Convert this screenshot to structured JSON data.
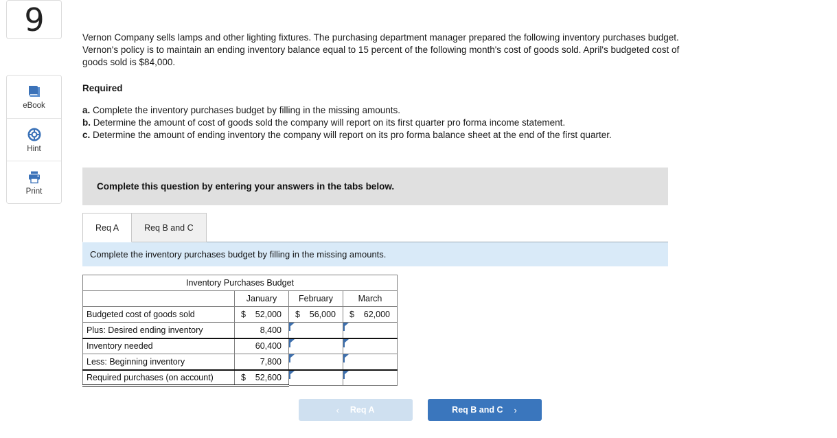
{
  "question_number": "9",
  "tools": [
    {
      "label": "eBook",
      "icon": "book-icon"
    },
    {
      "label": "Hint",
      "icon": "lifebuoy-icon"
    },
    {
      "label": "Print",
      "icon": "printer-icon"
    }
  ],
  "problem": {
    "paragraph": "Vernon Company sells lamps and other lighting fixtures. The purchasing department manager prepared the following inventory purchases budget. Vernon's policy is to maintain an ending inventory balance equal to 15 percent of the following month's cost of goods sold. April's budgeted cost of goods sold is $84,000.",
    "required_heading": "Required",
    "requirements": [
      {
        "marker": "a.",
        "text": "Complete the inventory purchases budget by filling in the missing amounts."
      },
      {
        "marker": "b.",
        "text": "Determine the amount of cost of goods sold the company will report on its first quarter pro forma income statement."
      },
      {
        "marker": "c.",
        "text": "Determine the amount of ending inventory the company will report on its pro forma balance sheet at the end of the first quarter."
      }
    ]
  },
  "instruction_bar": "Complete this question by entering your answers in the tabs below.",
  "tabs": [
    {
      "label": "Req A",
      "active": true
    },
    {
      "label": "Req B and C",
      "active": false
    }
  ],
  "tab_instruction": "Complete the inventory purchases budget by filling in the missing amounts.",
  "table": {
    "title": "Inventory Purchases Budget",
    "columns": [
      "January",
      "February",
      "March"
    ],
    "rows": [
      {
        "label": "Budgeted cost of goods sold",
        "cells": [
          {
            "currency": "$",
            "value": "52,000",
            "input": false
          },
          {
            "currency": "$",
            "value": "56,000",
            "input": false
          },
          {
            "currency": "$",
            "value": "62,000",
            "input": false
          }
        ],
        "rule": "none"
      },
      {
        "label": "Plus: Desired ending inventory",
        "cells": [
          {
            "currency": "",
            "value": "8,400",
            "input": false
          },
          {
            "currency": "",
            "value": "",
            "input": true
          },
          {
            "currency": "",
            "value": "",
            "input": true
          }
        ],
        "rule": "single"
      },
      {
        "label": "Inventory needed",
        "cells": [
          {
            "currency": "",
            "value": "60,400",
            "input": false
          },
          {
            "currency": "",
            "value": "",
            "input": true
          },
          {
            "currency": "",
            "value": "",
            "input": true
          }
        ],
        "rule": "none"
      },
      {
        "label": "Less: Beginning inventory",
        "cells": [
          {
            "currency": "",
            "value": "7,800",
            "input": false
          },
          {
            "currency": "",
            "value": "",
            "input": true
          },
          {
            "currency": "",
            "value": "",
            "input": true
          }
        ],
        "rule": "single"
      },
      {
        "label": "Required purchases (on account)",
        "cells": [
          {
            "currency": "$",
            "value": "52,600",
            "input": false
          },
          {
            "currency": "",
            "value": "",
            "input": true
          },
          {
            "currency": "",
            "value": "",
            "input": true
          }
        ],
        "rule": "grand"
      }
    ]
  },
  "nav": {
    "prev_label": "Req A",
    "prev_chevron": "‹",
    "next_label": "Req B and C",
    "next_chevron": "›"
  },
  "colors": {
    "table_header_blue": "#7fb0e2",
    "instruction_grey": "#e0e0e0",
    "instruction_blue": "#d9eaf8",
    "accent_blue": "#3a76bd",
    "input_border": "#4a7ebb",
    "icon_blue": "#3b72b8"
  }
}
